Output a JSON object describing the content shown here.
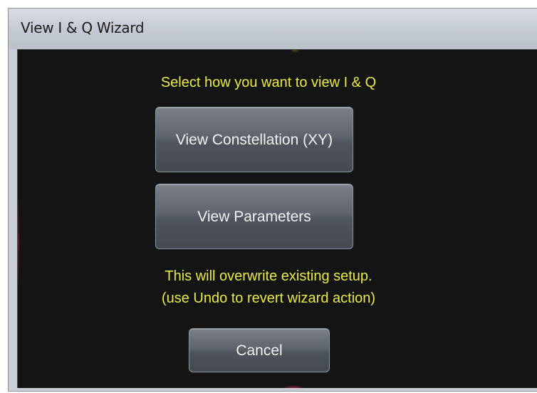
{
  "window": {
    "title": "View I & Q Wizard"
  },
  "dialog": {
    "prompt": "Select how you want to view I & Q",
    "buttons": {
      "view_constellation": "View Constellation (XY)",
      "view_parameters": "View Parameters",
      "cancel": "Cancel"
    },
    "warning_line1": "This will overwrite existing setup.",
    "warning_line2": "(use Undo to revert wizard action)"
  },
  "colors": {
    "prompt_text": "#e9e94a",
    "background": "#141414",
    "button_text": "#f2f2f2"
  }
}
